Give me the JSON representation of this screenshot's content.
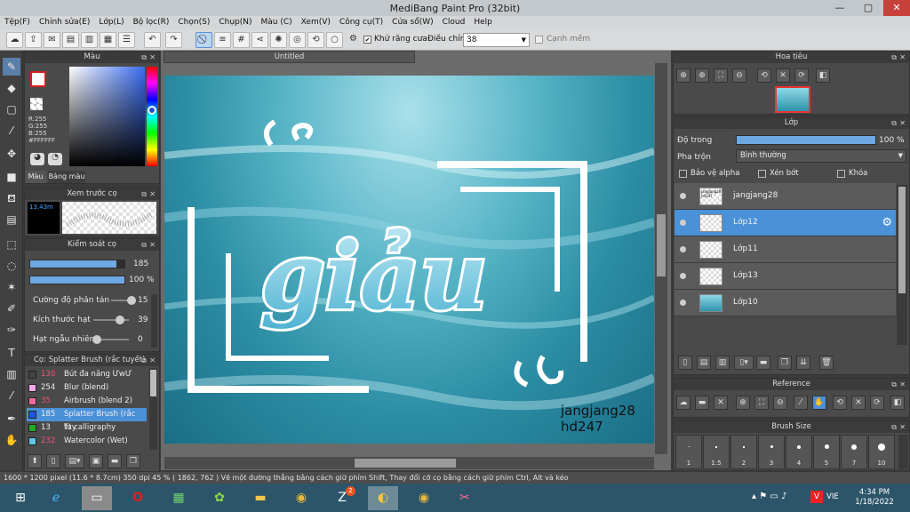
{
  "window": {
    "title": "MediBang Paint Pro (32bit)"
  },
  "menu": [
    "Tệp(F)",
    "Chỉnh sửa(E)",
    "Lớp(L)",
    "Bộ lọc(R)",
    "Chọn(S)",
    "Chụp(N)",
    "Màu (C)",
    "Xem(V)",
    "Công cụ(T)",
    "Cửa sổ(W)",
    "Cloud",
    "Help"
  ],
  "toolbar": {
    "antialias_label": "Khử răng cưa",
    "adjust_label": "Điều chỉnh",
    "adjust_value": "38",
    "strong_label": "Cạnh mềm"
  },
  "color_panel": {
    "title": "Màu",
    "r": "R:255",
    "g": "G:255",
    "b": "B:255",
    "hex": "#FFFFFF",
    "tabs": [
      "Màu",
      "Bảng màu"
    ]
  },
  "brush_preview": {
    "title": "Xem trước cọ",
    "size_text": "13.43m"
  },
  "brush_control": {
    "title": "Kiểm soát cọ",
    "size_value": "185",
    "size_level": 0.92,
    "opacity_value": "100 %",
    "opacity_level": 1.0,
    "params": [
      {
        "label": "Cường độ phân tán",
        "value": "15",
        "level": 0.9
      },
      {
        "label": "Kích thước hạt",
        "value": "39",
        "level": 0.75
      },
      {
        "label": "Hạt ngẫu nhiên",
        "value": "0",
        "level": 0.1
      }
    ]
  },
  "brush_list": {
    "title": "Cọ: Splatter Brush (rắc tuyết)",
    "items": [
      {
        "num": "130",
        "name": "Bút đa năng ƯwƯ",
        "color": "#444444"
      },
      {
        "num": "254",
        "name": "Blur (blend)",
        "color": "#f5a8e8"
      },
      {
        "num": "35",
        "name": "Airbrush (blend 2)",
        "color": "#f06aa0"
      },
      {
        "num": "185",
        "name": "Splatter Brush (rắc tuy",
        "color": "#2255dd"
      },
      {
        "num": "13",
        "name": "Tt calligraphy",
        "color": "#22aa22"
      },
      {
        "num": "232",
        "name": "Watercolor (Wet)",
        "color": "#5fc6e8"
      }
    ]
  },
  "canvas": {
    "tab_title": "Untitled",
    "word": "giảu",
    "signature_line1": "jangjang28",
    "signature_line2": "hd247"
  },
  "navigator": {
    "title": "Hoa tiêu"
  },
  "layer_panel": {
    "title": "Lớp",
    "opacity_label": "Độ trong",
    "opacity_value": "100 %",
    "opacity_level": 1.0,
    "blend_label": "Pha trộn",
    "blend_value": "Bình thường",
    "checks": [
      "Bảo vệ alpha",
      "Xén bớt",
      "Khóa"
    ],
    "layers": [
      {
        "name": "jangjang28",
        "thumb_text": "jangjang28 hd247",
        "selected": false
      },
      {
        "name": "Lớp12",
        "selected": true
      },
      {
        "name": "Lớp11",
        "selected": false
      },
      {
        "name": "Lớp13",
        "selected": false
      },
      {
        "name": "Lớp10",
        "selected": false
      }
    ]
  },
  "reference_panel": {
    "title": "Reference"
  },
  "brush_size_panel": {
    "title": "Brush Size",
    "sizes": [
      "1",
      "1.5",
      "2",
      "3",
      "4",
      "5",
      "7",
      "10"
    ]
  },
  "status": {
    "text": "1600 * 1200 pixel   (11.6 * 8.7cm)   350 dpi   45 %   ( 1862, 762 )   Vẽ một đường thẳng bằng cách giữ phím Shift, Thay đổi cỡ cọ bằng cách giữ phím Ctrl, Alt và kéo"
  },
  "taskbar": {
    "lang": "VIE",
    "time": "4:34 PM",
    "date": "1/18/2022",
    "zalo_badge": "2"
  }
}
